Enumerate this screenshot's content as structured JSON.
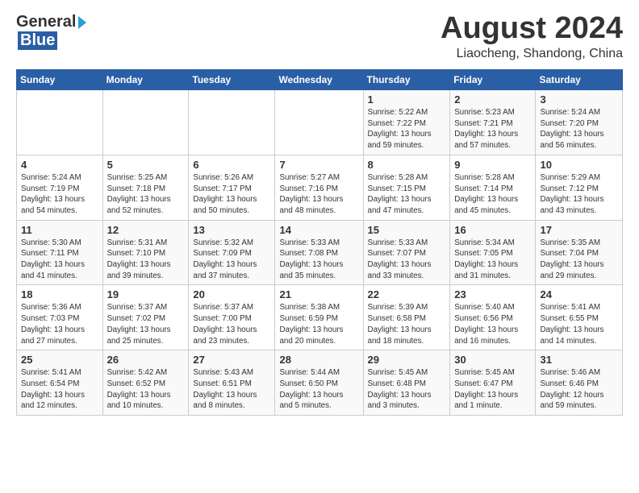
{
  "logo": {
    "general": "General",
    "blue": "Blue"
  },
  "title": "August 2024",
  "location": "Liaocheng, Shandong, China",
  "days_of_week": [
    "Sunday",
    "Monday",
    "Tuesday",
    "Wednesday",
    "Thursday",
    "Friday",
    "Saturday"
  ],
  "weeks": [
    [
      {
        "date": "",
        "info": ""
      },
      {
        "date": "",
        "info": ""
      },
      {
        "date": "",
        "info": ""
      },
      {
        "date": "",
        "info": ""
      },
      {
        "date": "1",
        "info": "Sunrise: 5:22 AM\nSunset: 7:22 PM\nDaylight: 13 hours\nand 59 minutes."
      },
      {
        "date": "2",
        "info": "Sunrise: 5:23 AM\nSunset: 7:21 PM\nDaylight: 13 hours\nand 57 minutes."
      },
      {
        "date": "3",
        "info": "Sunrise: 5:24 AM\nSunset: 7:20 PM\nDaylight: 13 hours\nand 56 minutes."
      }
    ],
    [
      {
        "date": "4",
        "info": "Sunrise: 5:24 AM\nSunset: 7:19 PM\nDaylight: 13 hours\nand 54 minutes."
      },
      {
        "date": "5",
        "info": "Sunrise: 5:25 AM\nSunset: 7:18 PM\nDaylight: 13 hours\nand 52 minutes."
      },
      {
        "date": "6",
        "info": "Sunrise: 5:26 AM\nSunset: 7:17 PM\nDaylight: 13 hours\nand 50 minutes."
      },
      {
        "date": "7",
        "info": "Sunrise: 5:27 AM\nSunset: 7:16 PM\nDaylight: 13 hours\nand 48 minutes."
      },
      {
        "date": "8",
        "info": "Sunrise: 5:28 AM\nSunset: 7:15 PM\nDaylight: 13 hours\nand 47 minutes."
      },
      {
        "date": "9",
        "info": "Sunrise: 5:28 AM\nSunset: 7:14 PM\nDaylight: 13 hours\nand 45 minutes."
      },
      {
        "date": "10",
        "info": "Sunrise: 5:29 AM\nSunset: 7:12 PM\nDaylight: 13 hours\nand 43 minutes."
      }
    ],
    [
      {
        "date": "11",
        "info": "Sunrise: 5:30 AM\nSunset: 7:11 PM\nDaylight: 13 hours\nand 41 minutes."
      },
      {
        "date": "12",
        "info": "Sunrise: 5:31 AM\nSunset: 7:10 PM\nDaylight: 13 hours\nand 39 minutes."
      },
      {
        "date": "13",
        "info": "Sunrise: 5:32 AM\nSunset: 7:09 PM\nDaylight: 13 hours\nand 37 minutes."
      },
      {
        "date": "14",
        "info": "Sunrise: 5:33 AM\nSunset: 7:08 PM\nDaylight: 13 hours\nand 35 minutes."
      },
      {
        "date": "15",
        "info": "Sunrise: 5:33 AM\nSunset: 7:07 PM\nDaylight: 13 hours\nand 33 minutes."
      },
      {
        "date": "16",
        "info": "Sunrise: 5:34 AM\nSunset: 7:05 PM\nDaylight: 13 hours\nand 31 minutes."
      },
      {
        "date": "17",
        "info": "Sunrise: 5:35 AM\nSunset: 7:04 PM\nDaylight: 13 hours\nand 29 minutes."
      }
    ],
    [
      {
        "date": "18",
        "info": "Sunrise: 5:36 AM\nSunset: 7:03 PM\nDaylight: 13 hours\nand 27 minutes."
      },
      {
        "date": "19",
        "info": "Sunrise: 5:37 AM\nSunset: 7:02 PM\nDaylight: 13 hours\nand 25 minutes."
      },
      {
        "date": "20",
        "info": "Sunrise: 5:37 AM\nSunset: 7:00 PM\nDaylight: 13 hours\nand 23 minutes."
      },
      {
        "date": "21",
        "info": "Sunrise: 5:38 AM\nSunset: 6:59 PM\nDaylight: 13 hours\nand 20 minutes."
      },
      {
        "date": "22",
        "info": "Sunrise: 5:39 AM\nSunset: 6:58 PM\nDaylight: 13 hours\nand 18 minutes."
      },
      {
        "date": "23",
        "info": "Sunrise: 5:40 AM\nSunset: 6:56 PM\nDaylight: 13 hours\nand 16 minutes."
      },
      {
        "date": "24",
        "info": "Sunrise: 5:41 AM\nSunset: 6:55 PM\nDaylight: 13 hours\nand 14 minutes."
      }
    ],
    [
      {
        "date": "25",
        "info": "Sunrise: 5:41 AM\nSunset: 6:54 PM\nDaylight: 13 hours\nand 12 minutes."
      },
      {
        "date": "26",
        "info": "Sunrise: 5:42 AM\nSunset: 6:52 PM\nDaylight: 13 hours\nand 10 minutes."
      },
      {
        "date": "27",
        "info": "Sunrise: 5:43 AM\nSunset: 6:51 PM\nDaylight: 13 hours\nand 8 minutes."
      },
      {
        "date": "28",
        "info": "Sunrise: 5:44 AM\nSunset: 6:50 PM\nDaylight: 13 hours\nand 5 minutes."
      },
      {
        "date": "29",
        "info": "Sunrise: 5:45 AM\nSunset: 6:48 PM\nDaylight: 13 hours\nand 3 minutes."
      },
      {
        "date": "30",
        "info": "Sunrise: 5:45 AM\nSunset: 6:47 PM\nDaylight: 13 hours\nand 1 minute."
      },
      {
        "date": "31",
        "info": "Sunrise: 5:46 AM\nSunset: 6:46 PM\nDaylight: 12 hours\nand 59 minutes."
      }
    ]
  ]
}
